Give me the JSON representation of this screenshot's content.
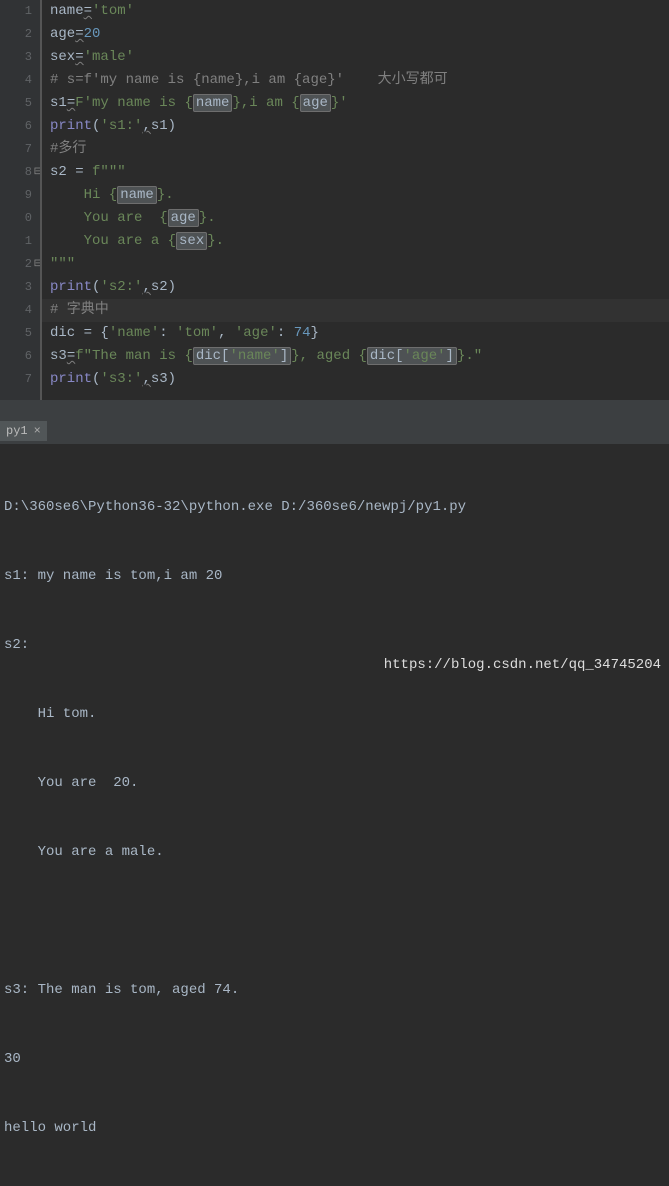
{
  "gutter": [
    "1",
    "2",
    "3",
    "4",
    "5",
    "6",
    "7",
    "8",
    "9",
    "0",
    "1",
    "2",
    "3",
    "4",
    "5",
    "6",
    "7"
  ],
  "code": {
    "l1": {
      "a": "name",
      "b": "=",
      "c": "'tom'"
    },
    "l2": {
      "a": "age",
      "b": "=",
      "c": "20"
    },
    "l3": {
      "a": "sex",
      "b": "=",
      "c": "'male'"
    },
    "l4": {
      "a": "# s=f'my name is {name},i am {age}'    大小写都可"
    },
    "l5": {
      "a": "s1",
      "b": "=",
      "c": "F",
      "d": "'my name is {",
      "e": "name",
      "f": "},i am {",
      "g": "age",
      "h": "}'"
    },
    "l6": {
      "a": "print",
      "b": "(",
      "c": "'s1:'",
      "d": ",",
      "e": "s1)"
    },
    "l7": {
      "a": "#多行"
    },
    "l8": {
      "a": "s2 = ",
      "b": "f",
      "c": "\"\"\""
    },
    "l9": {
      "a": "    Hi {",
      "b": "name",
      "c": "}."
    },
    "l10": {
      "a": "    You are  {",
      "b": "age",
      "c": "}."
    },
    "l11": {
      "a": "    You are a {",
      "b": "sex",
      "c": "}."
    },
    "l12": {
      "a": "\"\"\""
    },
    "l13": {
      "a": "print",
      "b": "(",
      "c": "'s2:'",
      "d": ",",
      "e": "s2)"
    },
    "l14": {
      "a": "# 字典中"
    },
    "l15": {
      "a": "dic = {",
      "b": "'name'",
      "c": ": ",
      "d": "'tom'",
      "e": ", ",
      "f": "'age'",
      "g": ": ",
      "h": "74",
      "i": "}"
    },
    "l16": {
      "a": "s3",
      "b": "=",
      "c": "f",
      "d": "\"The man is {",
      "e": "dic[",
      "f": "'name'",
      "g": "]",
      "h": "}, aged {",
      "i": "dic[",
      "j": "'age'",
      "k": "]",
      "l": "}.\""
    },
    "l17": {
      "a": "print",
      "b": "(",
      "c": "'s3:'",
      "d": ",",
      "e": "s3)"
    }
  },
  "tab": {
    "label": "py1",
    "close": "×"
  },
  "console": {
    "l1": "D:\\360se6\\Python36-32\\python.exe D:/360se6/newpj/py1.py",
    "l2": "s1: my name is tom,i am 20",
    "l3": "s2:",
    "l4": "    Hi tom.",
    "l5": "    You are  20.",
    "l6": "    You are a male.",
    "l7": "",
    "l8": "s3: The man is tom, aged 74.",
    "l9": "30",
    "l10": "hello world"
  },
  "watermark": "https://blog.csdn.net/qq_34745204"
}
